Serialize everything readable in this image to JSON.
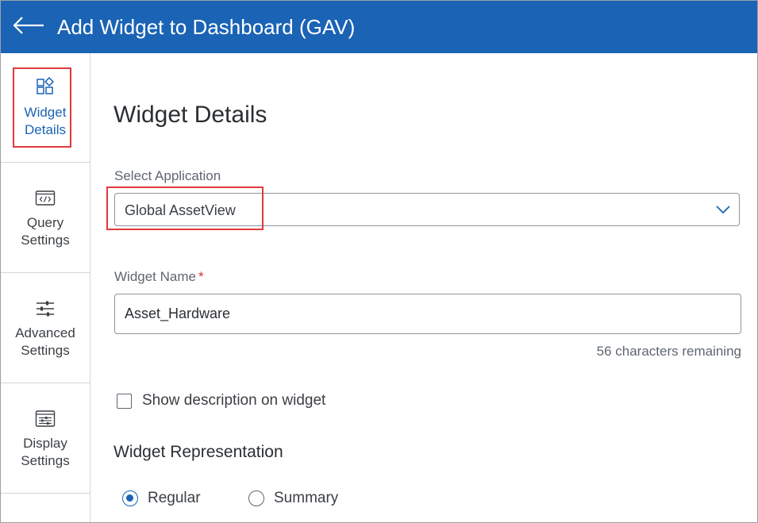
{
  "header": {
    "title": "Add Widget to Dashboard (GAV)",
    "back_icon": "arrow-left-icon",
    "background": "#1a63b5"
  },
  "sidebar": {
    "items": [
      {
        "label_line1": "Widget",
        "label_line2": "Details",
        "icon": "widgets-icon",
        "active": true
      },
      {
        "label_line1": "Query",
        "label_line2": "Settings",
        "icon": "code-icon",
        "active": false
      },
      {
        "label_line1": "Advanced",
        "label_line2": "Settings",
        "icon": "sliders-icon",
        "active": false
      },
      {
        "label_line1": "Display",
        "label_line2": "Settings",
        "icon": "display-settings-icon",
        "active": false
      }
    ]
  },
  "main": {
    "title": "Widget Details",
    "select_application": {
      "label": "Select Application",
      "value": "Global AssetView"
    },
    "widget_name": {
      "label": "Widget Name",
      "required_mark": "*",
      "value": "Asset_Hardware",
      "remaining": "56 characters remaining"
    },
    "show_description": {
      "label": "Show description on widget",
      "checked": false
    },
    "representation": {
      "title": "Widget Representation",
      "options": [
        {
          "label": "Regular",
          "checked": true
        },
        {
          "label": "Summary",
          "checked": false
        }
      ]
    }
  },
  "colors": {
    "accent": "#1a63b5",
    "highlight": "#e0393e",
    "required": "#d93025"
  }
}
